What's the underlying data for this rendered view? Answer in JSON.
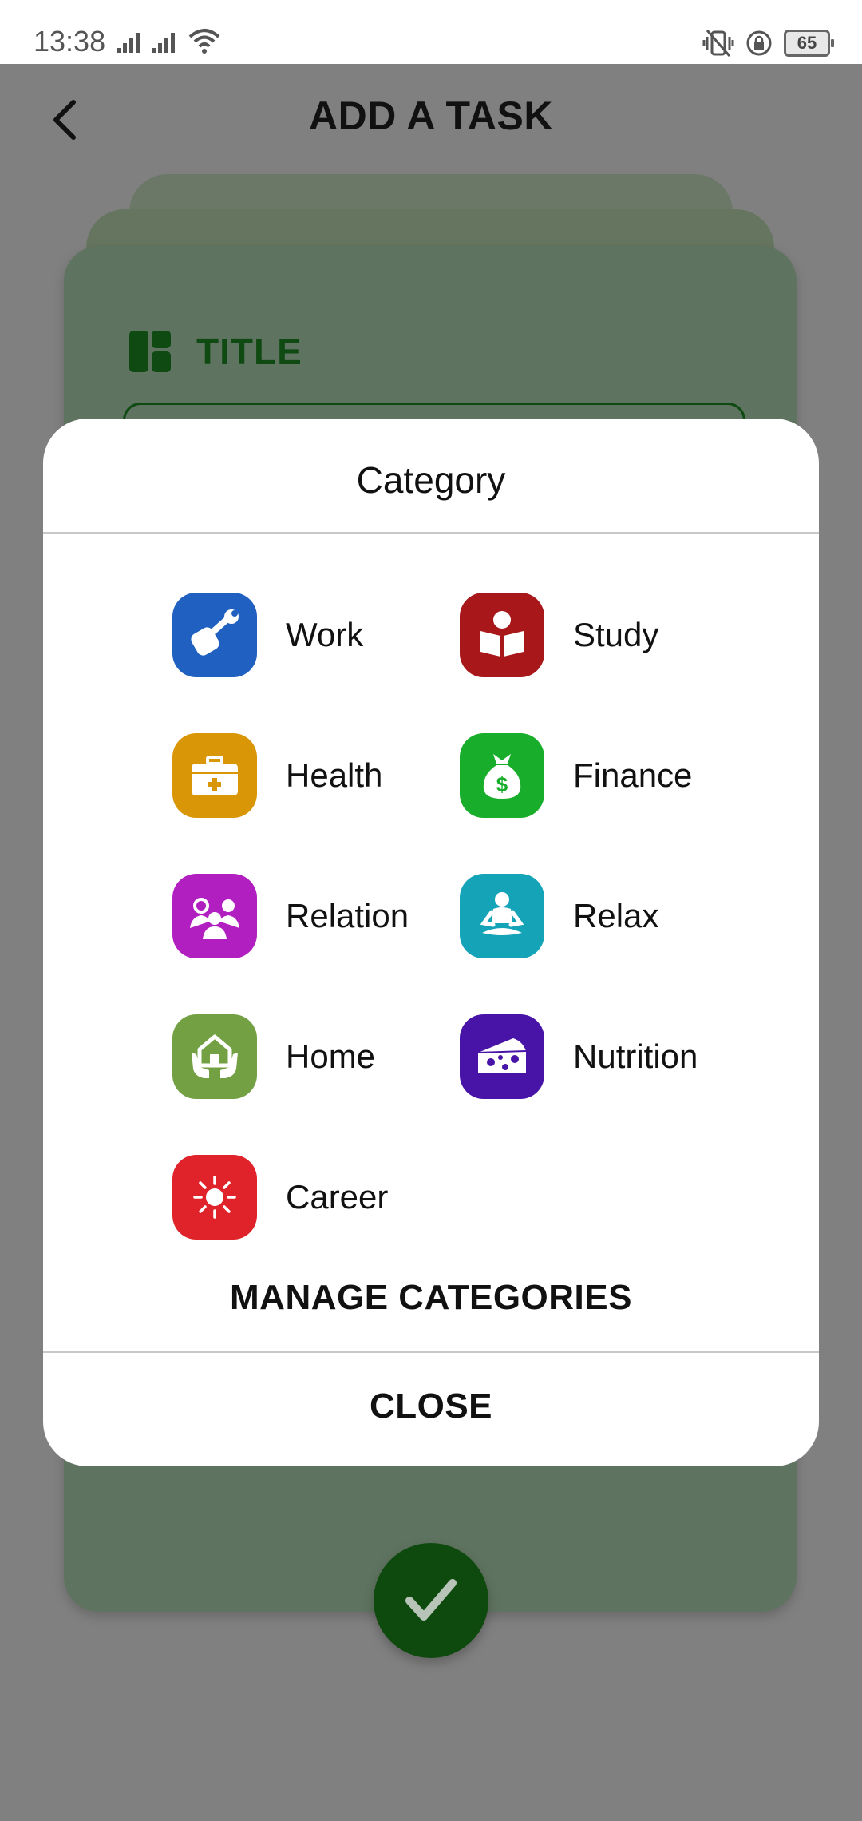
{
  "status": {
    "time": "13:38",
    "battery": "65"
  },
  "header": {
    "title": "ADD A TASK"
  },
  "form": {
    "title_label": "TITLE"
  },
  "dialog": {
    "title": "Category",
    "categories": [
      {
        "label": "Work",
        "color": "#2060c0",
        "icon": "wrench-fist-icon"
      },
      {
        "label": "Study",
        "color": "#a8171a",
        "icon": "reading-book-icon"
      },
      {
        "label": "Health",
        "color": "#d99606",
        "icon": "first-aid-kit-icon"
      },
      {
        "label": "Finance",
        "color": "#18ad2a",
        "icon": "money-bag-icon"
      },
      {
        "label": "Relation",
        "color": "#b11fc0",
        "icon": "people-talking-icon"
      },
      {
        "label": "Relax",
        "color": "#15a3b8",
        "icon": "meditation-icon"
      },
      {
        "label": "Home",
        "color": "#73a042",
        "icon": "house-in-hands-icon"
      },
      {
        "label": "Nutrition",
        "color": "#4814a8",
        "icon": "cheese-icon"
      },
      {
        "label": "Career",
        "color": "#e0232a",
        "icon": "sun-icon"
      }
    ],
    "manage_label": "MANAGE CATEGORIES",
    "close_label": "CLOSE"
  }
}
